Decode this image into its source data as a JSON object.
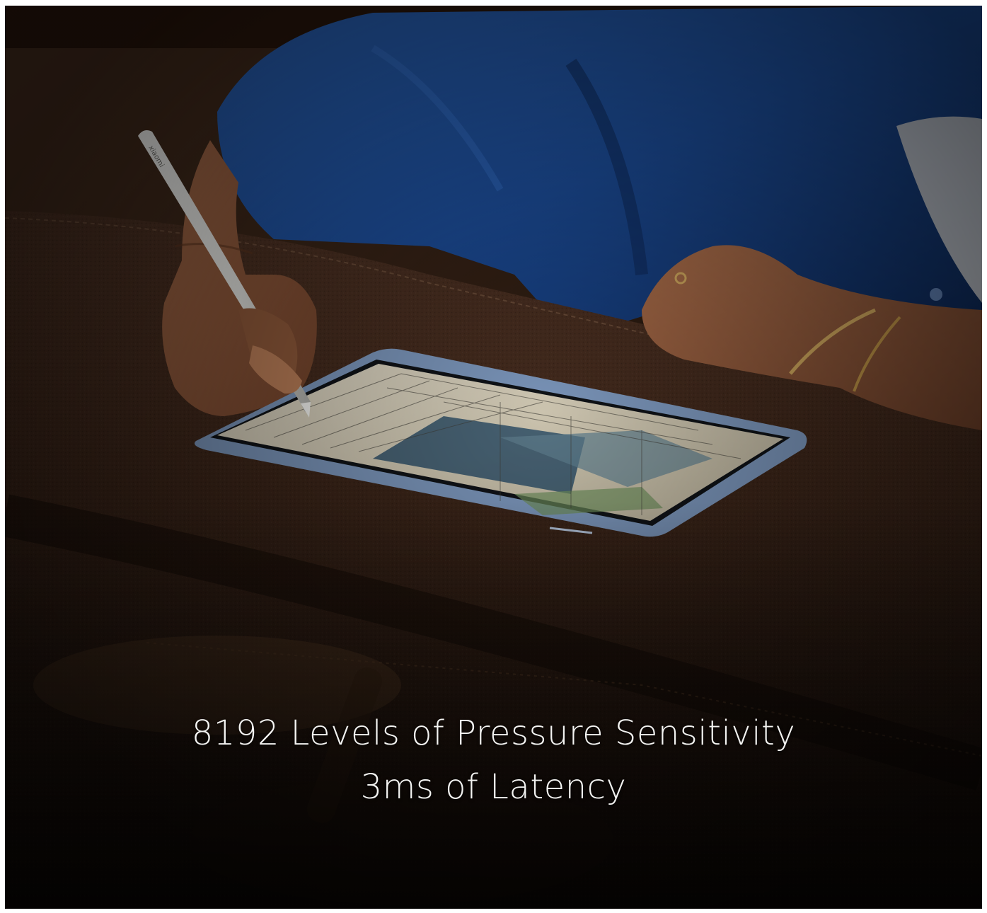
{
  "caption": {
    "line1": "8192 Levels of Pressure Sensitivity",
    "line2": "3ms of Latency"
  },
  "stylus": {
    "brand_text": "xiaomi"
  },
  "colors": {
    "shirt": "#1d4f9a",
    "desk_leather": "#3a2418",
    "tablet_frame": "#6d8ab0",
    "text": "#f4f4f2"
  }
}
